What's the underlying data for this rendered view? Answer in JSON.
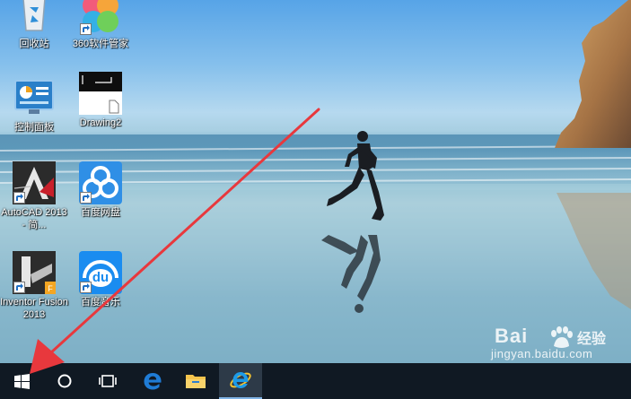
{
  "desktop": {
    "icons": [
      {
        "name": "recycle-bin",
        "label": "回收站",
        "icon": "recycle-bin-icon"
      },
      {
        "name": "360-software-manager",
        "label": "360软件管家",
        "icon": "360-software-manager-icon"
      },
      {
        "name": "control-panel",
        "label": "控制面板",
        "icon": "control-panel-icon"
      },
      {
        "name": "drawing2",
        "label": "Drawing2",
        "icon": "dwg-file-icon"
      },
      {
        "name": "autocad-2013",
        "label": "AutoCAD 2013 - 简...",
        "icon": "autocad-icon"
      },
      {
        "name": "baidu-netdisk",
        "label": "百度网盘",
        "icon": "baidu-netdisk-icon"
      },
      {
        "name": "inventor-fusion-2013",
        "label": "Inventor Fusion 2013",
        "icon": "inventor-fusion-icon"
      },
      {
        "name": "baidu-music",
        "label": "百度音乐",
        "icon": "baidu-music-icon",
        "icon_text": "du"
      }
    ]
  },
  "taskbar": {
    "items": [
      "start-icon",
      "cortana-icon",
      "task-view-icon",
      "edge-icon",
      "file-explorer-icon",
      "internet-explorer-icon"
    ]
  },
  "watermark": {
    "brand": "Bai",
    "brand_suffix": "经验",
    "url": "jingyan.baidu.com"
  },
  "colors": {
    "taskbar": "#101923",
    "arrow": "#e8383d",
    "edge": "#1f7cd6",
    "ie": "#1d9be8",
    "folder": "#f4c44d"
  }
}
